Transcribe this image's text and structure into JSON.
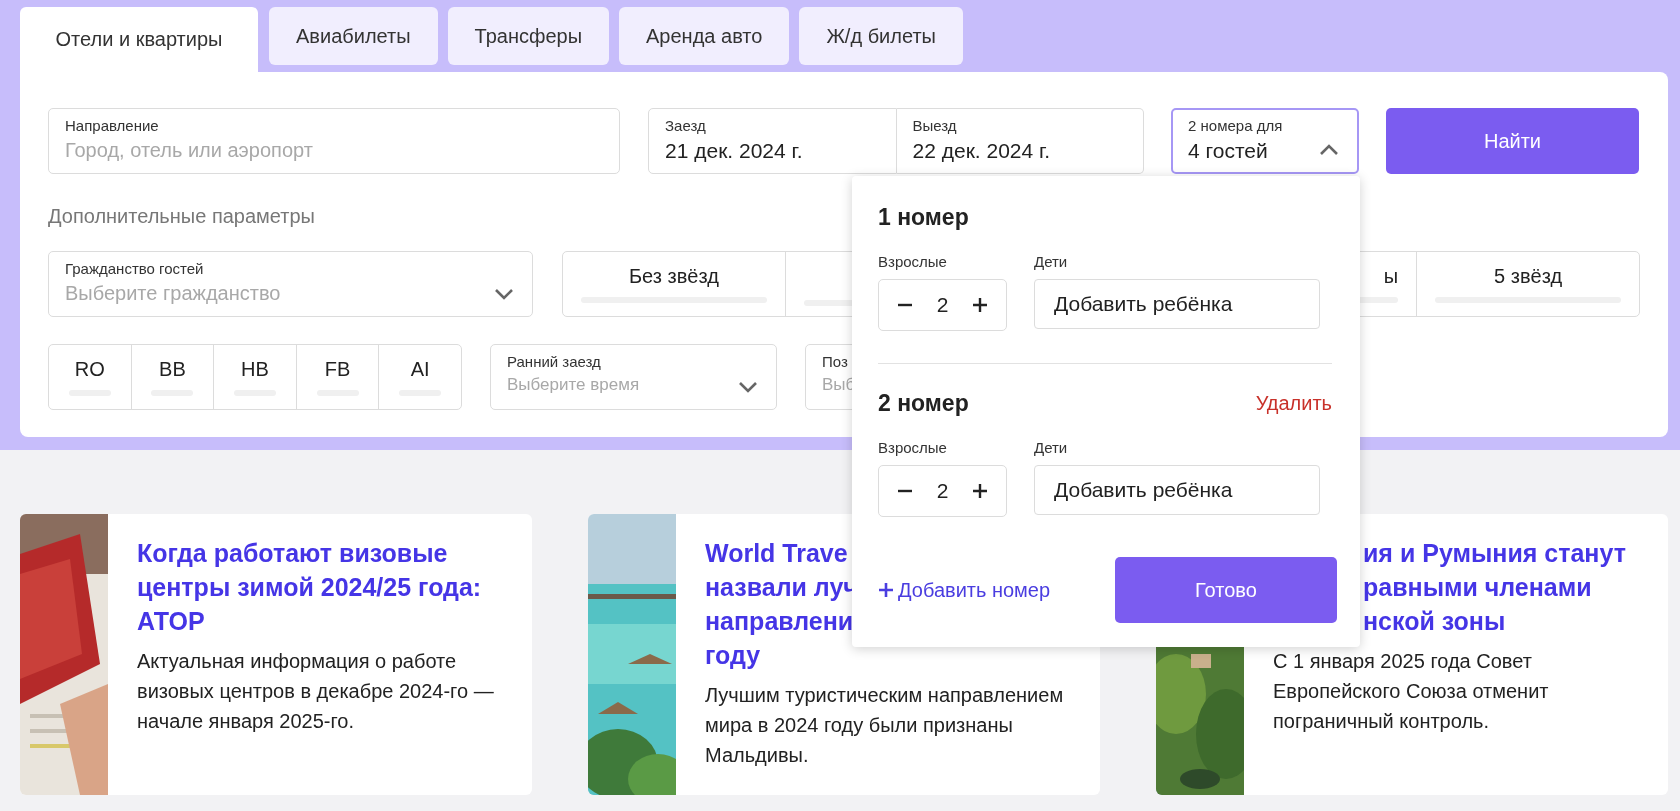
{
  "tabs": [
    {
      "label": "Отели и квартиры",
      "selected": true
    },
    {
      "label": "Авиабилеты",
      "selected": false
    },
    {
      "label": "Трансферы",
      "selected": false
    },
    {
      "label": "Аренда авто",
      "selected": false
    },
    {
      "label": "Ж/д билеты",
      "selected": false
    }
  ],
  "search": {
    "destination": {
      "label": "Направление",
      "placeholder": "Город, отель или аэропорт"
    },
    "checkin": {
      "label": "Заезд",
      "value": "21 дек. 2024 г."
    },
    "checkout": {
      "label": "Выезд",
      "value": "22 дек. 2024 г."
    },
    "guests": {
      "label": "2 номера для",
      "value": "4 гостей",
      "expanded": true
    },
    "submit": "Найти"
  },
  "extra_title": "Дополнительные параметры",
  "citizenship": {
    "label": "Гражданство гостей",
    "placeholder": "Выберите гражданство"
  },
  "stars": [
    {
      "kind": "labelled",
      "label": "Без звёзд"
    },
    {
      "kind": "covered"
    },
    {
      "kind": "labelled",
      "label": "ы"
    },
    {
      "kind": "labelled",
      "label": "5 звёзд"
    }
  ],
  "meals": [
    "RO",
    "BB",
    "HB",
    "FB",
    "AI"
  ],
  "early_checkin": {
    "label": "Ранний заезд",
    "placeholder": "Выберите время"
  },
  "late_checkin": {
    "label": "Поз",
    "placeholder": "Выб"
  },
  "guests_popup": {
    "rooms": [
      {
        "title": "1 номер",
        "adults_label": "Взрослые",
        "adults": "2",
        "children_label": "Дети",
        "add_child": "Добавить ребёнка"
      },
      {
        "title": "2 номер",
        "remove": "Удалить",
        "adults_label": "Взрослые",
        "adults": "2",
        "children_label": "Дети",
        "add_child": "Добавить ребёнка"
      }
    ],
    "add_room": "Добавить номер",
    "done": "Готово"
  },
  "articles": [
    {
      "title_lines": [
        "Когда работают визовые",
        "центры зимой 2024/25 года:",
        "АТОР"
      ],
      "text": "Актуальная информация о работе визовых центров в декабре 2024-го — начале января 2025-го."
    },
    {
      "title_lines": [
        "World Trave",
        "назвали луч",
        "направлени",
        "году"
      ],
      "text": "Лучшим туристическим направлением мира в 2024 году были признаны Мальдивы."
    },
    {
      "title_lines": [
        "ия и Румыния станут",
        "равными членами",
        "нской зоны"
      ],
      "text": "С 1 января 2025 года Совет Европейского Союза отменит пограничный контроль."
    }
  ]
}
